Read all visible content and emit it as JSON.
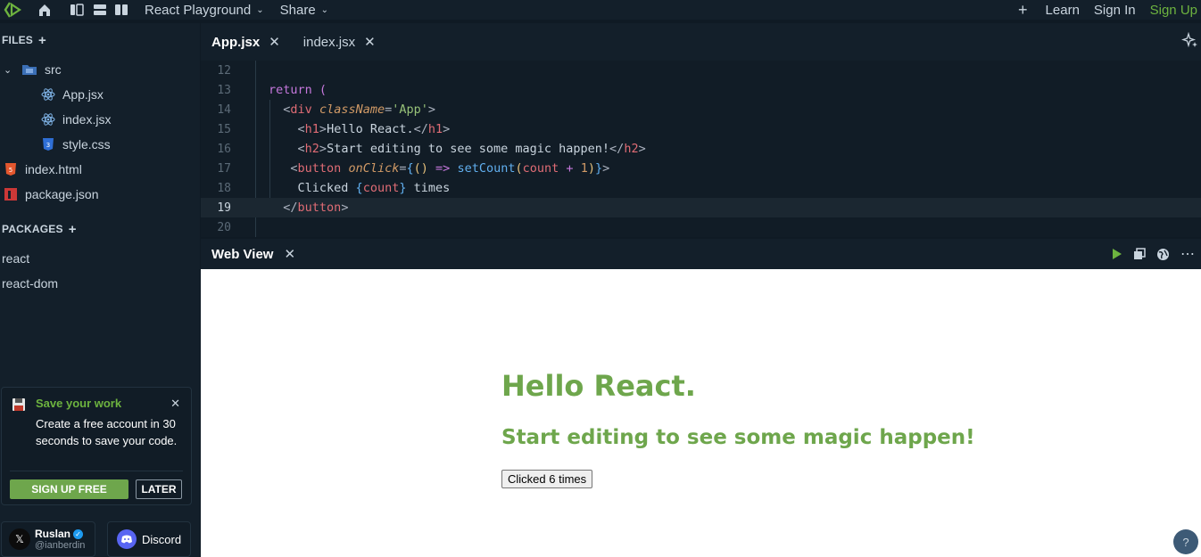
{
  "topbar": {
    "app_menu": "React Playground",
    "share_menu": "Share",
    "learn": "Learn",
    "sign_in": "Sign In",
    "sign_up": "Sign Up"
  },
  "sidebar": {
    "files_label": "FILES",
    "tree": [
      "src",
      "App.jsx",
      "index.jsx",
      "style.css",
      "index.html",
      "package.json"
    ],
    "packages_label": "PACKAGES",
    "packages": [
      "react",
      "react-dom"
    ]
  },
  "promo": {
    "title": "Save your work",
    "body": "Create a free account in 30 seconds to save your code.",
    "signup_btn": "SIGN UP FREE",
    "later_btn": "LATER"
  },
  "social": {
    "x_name": "Ruslan",
    "x_handle": "@ianberdin",
    "discord": "Discord"
  },
  "tabs": [
    {
      "label": "App.jsx",
      "active": true
    },
    {
      "label": "index.jsx",
      "active": false
    }
  ],
  "editor": {
    "line_numbers": [
      "12",
      "13",
      "14",
      "15",
      "16",
      "17",
      "18",
      "19",
      "20"
    ],
    "active_line": "19"
  },
  "webview": {
    "tab_label": "Web View",
    "h1": "Hello React.",
    "h2": "Start editing to see some magic happen!",
    "button": "Clicked 6 times"
  },
  "help": "?",
  "colors": {
    "accent_green": "#6db33f",
    "background": "#131f2a",
    "editor_bg": "#111c26"
  }
}
